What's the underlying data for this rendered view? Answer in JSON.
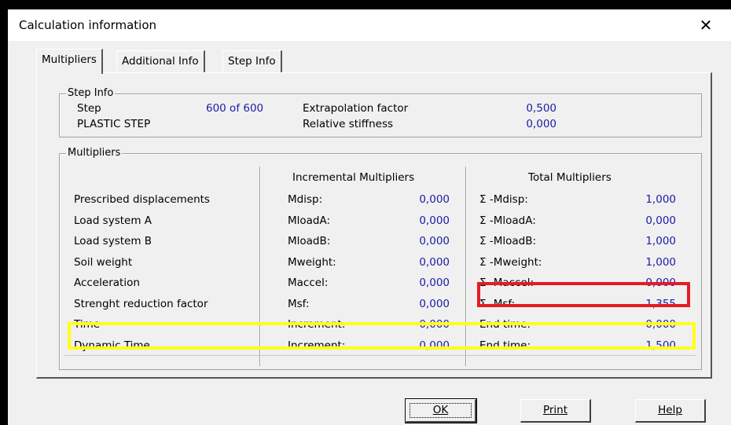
{
  "window": {
    "title": "Calculation information",
    "close_glyph": "✕"
  },
  "tabs": [
    {
      "label": "Multipliers"
    },
    {
      "label": "Additional Info"
    },
    {
      "label": "Step Info"
    }
  ],
  "step_info": {
    "legend": "Step Info",
    "step_label": "Step",
    "step_value": "600 of 600",
    "phase_label": "PLASTIC STEP",
    "extrapolation_label": "Extrapolation factor",
    "extrapolation_value": "0,500",
    "stiffness_label": "Relative stiffness",
    "stiffness_value": "0,000"
  },
  "multipliers": {
    "legend": "Multipliers",
    "incremental_header": "Incremental Multipliers",
    "total_header": "Total Multipliers",
    "rows": [
      {
        "name": "Prescribed displacements",
        "inc_label": "Mdisp:",
        "inc_value": "0,000",
        "tot_label": "Σ -Mdisp:",
        "tot_value": "1,000"
      },
      {
        "name": "Load system A",
        "inc_label": "MloadA:",
        "inc_value": "0,000",
        "tot_label": "Σ -MloadA:",
        "tot_value": "0,000"
      },
      {
        "name": "Load system B",
        "inc_label": "MloadB:",
        "inc_value": "0,000",
        "tot_label": "Σ -MloadB:",
        "tot_value": "1,000"
      },
      {
        "name": "Soil weight",
        "inc_label": "Mweight:",
        "inc_value": "0,000",
        "tot_label": "Σ -Mweight:",
        "tot_value": "1,000"
      },
      {
        "name": "Acceleration",
        "inc_label": "Maccel:",
        "inc_value": "0,000",
        "tot_label": "Σ -Maccel:",
        "tot_value": "0,000"
      },
      {
        "name": "Strenght reduction factor",
        "inc_label": "Msf:",
        "inc_value": "0,000",
        "tot_label": "Σ -Msf:",
        "tot_value": "1,355"
      },
      {
        "name": "Time",
        "inc_label": "Increment:",
        "inc_value": "0,000",
        "tot_label": "End time:",
        "tot_value": "0,000"
      },
      {
        "name": "Dynamic Time",
        "inc_label": "Increment:",
        "inc_value": "0,000",
        "tot_label": "End time:",
        "tot_value": "1,500"
      }
    ]
  },
  "buttons": {
    "ok_label": "OK",
    "print_label": "Print",
    "help_label": "Help"
  },
  "colors": {
    "value_text": "#1a1aa8",
    "highlight_red": "#e51b24",
    "highlight_yellow": "#ffff19"
  }
}
